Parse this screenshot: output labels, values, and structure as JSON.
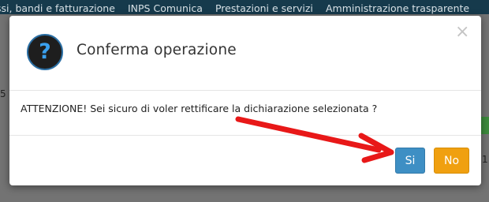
{
  "topnav": {
    "items": [
      "ssi, bandi e fatturazione",
      "INPS Comunica",
      "Prestazioni e servizi",
      "Amministrazione trasparente"
    ]
  },
  "background": {
    "left_digit": "5",
    "right_digit": "1"
  },
  "modal": {
    "icon": "question-icon",
    "icon_glyph": "?",
    "title": "Conferma operazione",
    "close_glyph": "×",
    "message": "ATTENZIONE! Sei sicuro di voler rettificare la dichiarazione selezionata ?",
    "yes_label": "Si",
    "no_label": "No"
  },
  "colors": {
    "nav_bar": "#163a4c",
    "yes_button": "#3e8fc4",
    "no_button": "#f0a010",
    "annotation_arrow": "#e81818",
    "icon_accent": "#3aa0ee"
  }
}
